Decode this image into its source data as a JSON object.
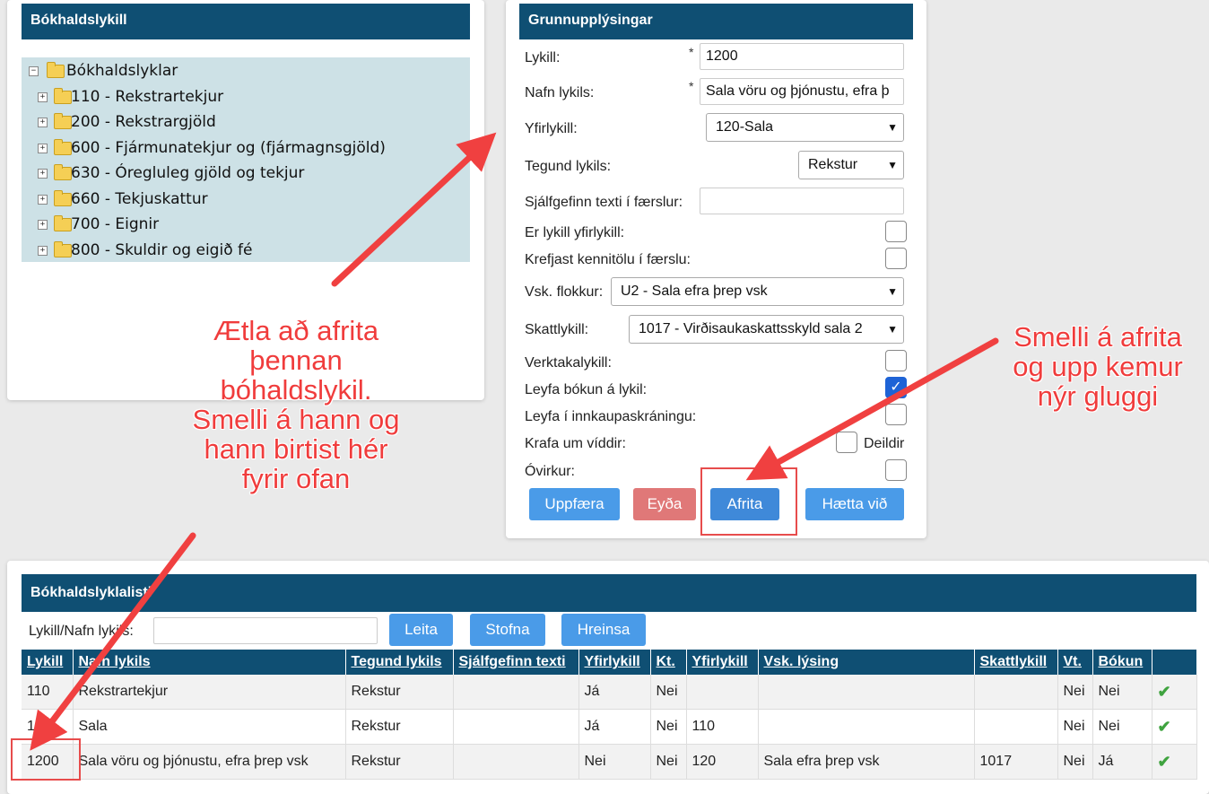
{
  "tree_panel": {
    "title": "Bókhaldslykill",
    "root_label": "Bókhaldslyklar",
    "items": [
      {
        "label": "110 - Rekstrartekjur"
      },
      {
        "label": "200 - Rekstrargjöld"
      },
      {
        "label": "600 - Fjármunatekjur og (fjármagnsgjöld)"
      },
      {
        "label": "630 - Óregluleg gjöld og tekjur"
      },
      {
        "label": "660 - Tekjuskattur"
      },
      {
        "label": "700 - Eignir"
      },
      {
        "label": "800 - Skuldir og eigið fé"
      }
    ]
  },
  "form": {
    "title": "Grunnupplýsingar",
    "required_mark": "*",
    "lykill_label": "Lykill:",
    "lykill_value": "1200",
    "nafn_label": "Nafn lykils:",
    "nafn_value": "Sala vöru og þjónustu, efra þ",
    "yfirlykill_label": "Yfirlykill:",
    "yfirlykill_value": "120-Sala",
    "tegund_label": "Tegund lykils:",
    "tegund_value": "Rekstur",
    "sjalfgefinn_label": "Sjálfgefinn texti í færslur:",
    "sjalfgefinn_value": "",
    "er_yfirlykill_label": "Er lykill yfirlykill:",
    "er_yfirlykill_checked": false,
    "krefjast_label": "Krefjast kennitölu í færslu:",
    "krefjast_checked": false,
    "vsk_label": "Vsk. flokkur:",
    "vsk_value": "U2 - Sala efra þrep vsk",
    "skatt_label": "Skattlykill:",
    "skatt_value": "1017 - Virðisaukaskattsskyld sala 2",
    "verktaka_label": "Verktakalykill:",
    "verktaka_checked": false,
    "leyfa_bokun_label": "Leyfa bókun á lykil:",
    "leyfa_bokun_checked": true,
    "leyfa_innkaup_label": "Leyfa í innkaupaskráningu:",
    "leyfa_innkaup_checked": false,
    "krafa_label": "Krafa um víddir:",
    "krafa_checked": false,
    "deildir_label": "Deildir",
    "ovirkur_label": "Óvirkur:",
    "ovirkur_checked": false,
    "buttons": {
      "update": "Uppfæra",
      "delete": "Eyða",
      "copy": "Afrita",
      "cancel": "Hætta við"
    },
    "check_glyph": "✓"
  },
  "list_panel": {
    "title": "Bókhaldslyklalisti",
    "search_label": "Lykill/Nafn lykils:",
    "search_value": "",
    "buttons": {
      "search": "Leita",
      "create": "Stofna",
      "clear": "Hreinsa"
    },
    "columns": [
      "Lykill",
      "Nafn lykils",
      "Tegund lykils",
      "Sjálfgefinn texti",
      "Yfirlykill",
      "Kt.",
      "Yfirlykill",
      "Vsk. lýsing",
      "Skattlykill",
      "Vt.",
      "Bókun",
      ""
    ],
    "rows": [
      [
        "110",
        "Rekstrartekjur",
        "Rekstur",
        "",
        "Já",
        "Nei",
        "",
        "",
        "",
        "Nei",
        "Nei",
        "✔"
      ],
      [
        "1",
        "Sala",
        "Rekstur",
        "",
        "Já",
        "Nei",
        "110",
        "",
        "",
        "Nei",
        "Nei",
        "✔"
      ],
      [
        "1200",
        "Sala vöru og þjónustu, efra þrep vsk",
        "Rekstur",
        "",
        "Nei",
        "Nei",
        "120",
        "Sala efra þrep vsk",
        "1017",
        "Nei",
        "Já",
        "✔"
      ]
    ]
  },
  "annotations": {
    "left_note": [
      "Ætla að afrita",
      "þennan",
      "bóhaldslykil.",
      "Smelli á hann og",
      "hann birtist hér",
      "fyrir ofan"
    ],
    "right_note": [
      "Smelli á afrita",
      "og upp kemur",
      "nýr gluggi"
    ]
  }
}
